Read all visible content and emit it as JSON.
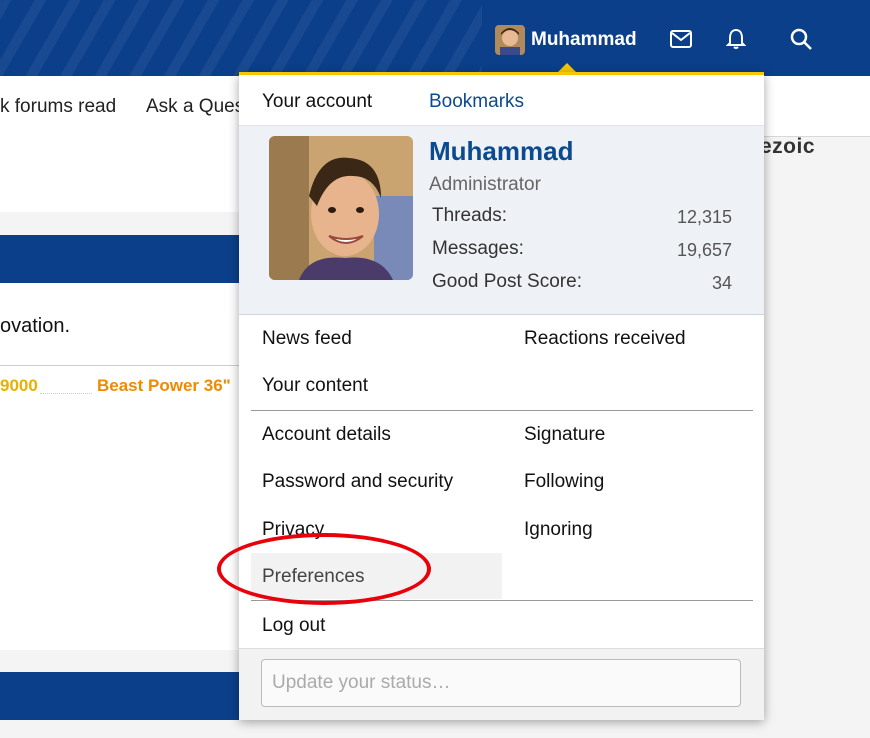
{
  "topbar": {
    "username": "Muhammad",
    "icons": [
      "envelope-icon",
      "bell-icon",
      "search-icon"
    ]
  },
  "subnav": {
    "items": [
      "k forums read",
      "Ask a Ques"
    ]
  },
  "background": {
    "ezoic": "ezoic",
    "text_line": "ovation.",
    "marquee_left": "9000",
    "marquee_right": "Beast Power 36\""
  },
  "popup": {
    "tabs": [
      "Your account",
      "Bookmarks"
    ],
    "profile": {
      "name": "Muhammad",
      "role": "Administrator",
      "stats": [
        {
          "label": "Threads:",
          "value": "12,315"
        },
        {
          "label": "Messages:",
          "value": "19,657"
        },
        {
          "label": "Good Post Score:",
          "value": "34"
        }
      ]
    },
    "menu_group1": {
      "left": [
        "News feed",
        "Your content"
      ],
      "right": [
        "Reactions received"
      ]
    },
    "menu_group2": {
      "left": [
        "Account details",
        "Password and security",
        "Privacy",
        "Preferences"
      ],
      "right": [
        "Signature",
        "Following",
        "Ignoring"
      ]
    },
    "logout": "Log out",
    "status_placeholder": "Update your status…"
  },
  "colors": {
    "brand_blue": "#0b3f8a",
    "accent_yellow": "#f7c600",
    "annotation_red": "#e8000b"
  }
}
